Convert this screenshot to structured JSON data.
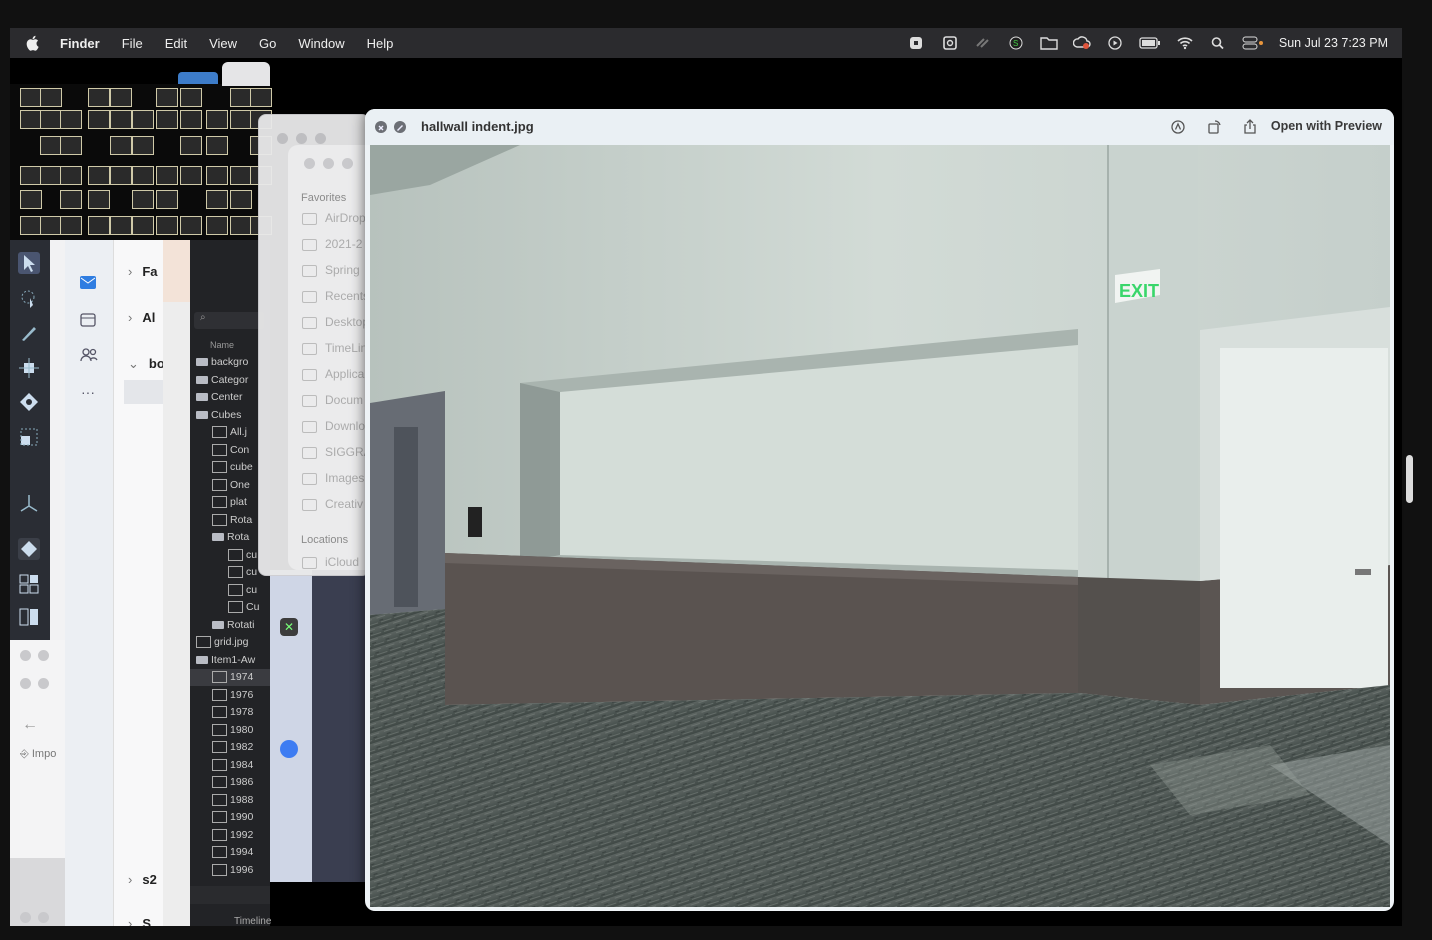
{
  "menubar": {
    "app": "Finder",
    "items": [
      "File",
      "Edit",
      "View",
      "Go",
      "Window",
      "Help"
    ],
    "clock": "Sun Jul 23  7:23 PM"
  },
  "quicklook": {
    "title": "hallwall indent.jpg",
    "open_button": "Open with Preview",
    "exit_sign": "EXIT"
  },
  "finder_sidebar": {
    "favorites_label": "Favorites",
    "favorites": [
      "AirDrop",
      "2021-2",
      "Spring",
      "Recents",
      "Desktop",
      "TimeLin",
      "Applica",
      "Docum",
      "Downlo",
      "SIGGRA",
      "Images",
      "Creativ"
    ],
    "locations_label": "Locations",
    "locations": [
      "iCloud"
    ]
  },
  "file_list": {
    "header": "Name",
    "rows": [
      {
        "name": "backgro",
        "kind": "folder",
        "indent": 0
      },
      {
        "name": "Categor",
        "kind": "folder",
        "indent": 0
      },
      {
        "name": "Center",
        "kind": "folder",
        "indent": 0
      },
      {
        "name": "Cubes",
        "kind": "folder",
        "indent": 0
      },
      {
        "name": "All.j",
        "kind": "image",
        "indent": 1
      },
      {
        "name": "Con",
        "kind": "image",
        "indent": 1
      },
      {
        "name": "cube",
        "kind": "file",
        "indent": 1
      },
      {
        "name": "One",
        "kind": "image",
        "indent": 1
      },
      {
        "name": "plat",
        "kind": "file",
        "indent": 1
      },
      {
        "name": "Rota",
        "kind": "image",
        "indent": 1
      },
      {
        "name": "Rota",
        "kind": "folder",
        "indent": 1
      },
      {
        "name": "cu",
        "kind": "image",
        "indent": 2
      },
      {
        "name": "cu",
        "kind": "image",
        "indent": 2
      },
      {
        "name": "cu",
        "kind": "image",
        "indent": 2
      },
      {
        "name": "Cu",
        "kind": "image",
        "indent": 2
      },
      {
        "name": "Rotati",
        "kind": "folder",
        "indent": 1
      },
      {
        "name": "grid.jpg",
        "kind": "file",
        "indent": 0
      },
      {
        "name": "Item1-Aw",
        "kind": "folder",
        "indent": 0
      },
      {
        "name": "1974",
        "kind": "image",
        "indent": 1
      },
      {
        "name": "1976",
        "kind": "image",
        "indent": 1
      },
      {
        "name": "1978",
        "kind": "image",
        "indent": 1
      },
      {
        "name": "1980",
        "kind": "image",
        "indent": 1
      },
      {
        "name": "1982",
        "kind": "image",
        "indent": 1
      },
      {
        "name": "1984",
        "kind": "image",
        "indent": 1
      },
      {
        "name": "1986",
        "kind": "image",
        "indent": 1
      },
      {
        "name": "1988",
        "kind": "image",
        "indent": 1
      },
      {
        "name": "1990",
        "kind": "image",
        "indent": 1
      },
      {
        "name": "1992",
        "kind": "image",
        "indent": 1
      },
      {
        "name": "1994",
        "kind": "image",
        "indent": 1
      },
      {
        "name": "1996",
        "kind": "image",
        "indent": 1
      }
    ],
    "footer": "Timeline"
  },
  "mail_pane": {
    "rows": [
      "Fa",
      "Al",
      "bo",
      "s2",
      "S"
    ]
  },
  "import_label": "Impo",
  "colors": {
    "accent": "#3a4fcf",
    "menubar": "#2b2b2e",
    "exit_green": "#39d66b"
  }
}
